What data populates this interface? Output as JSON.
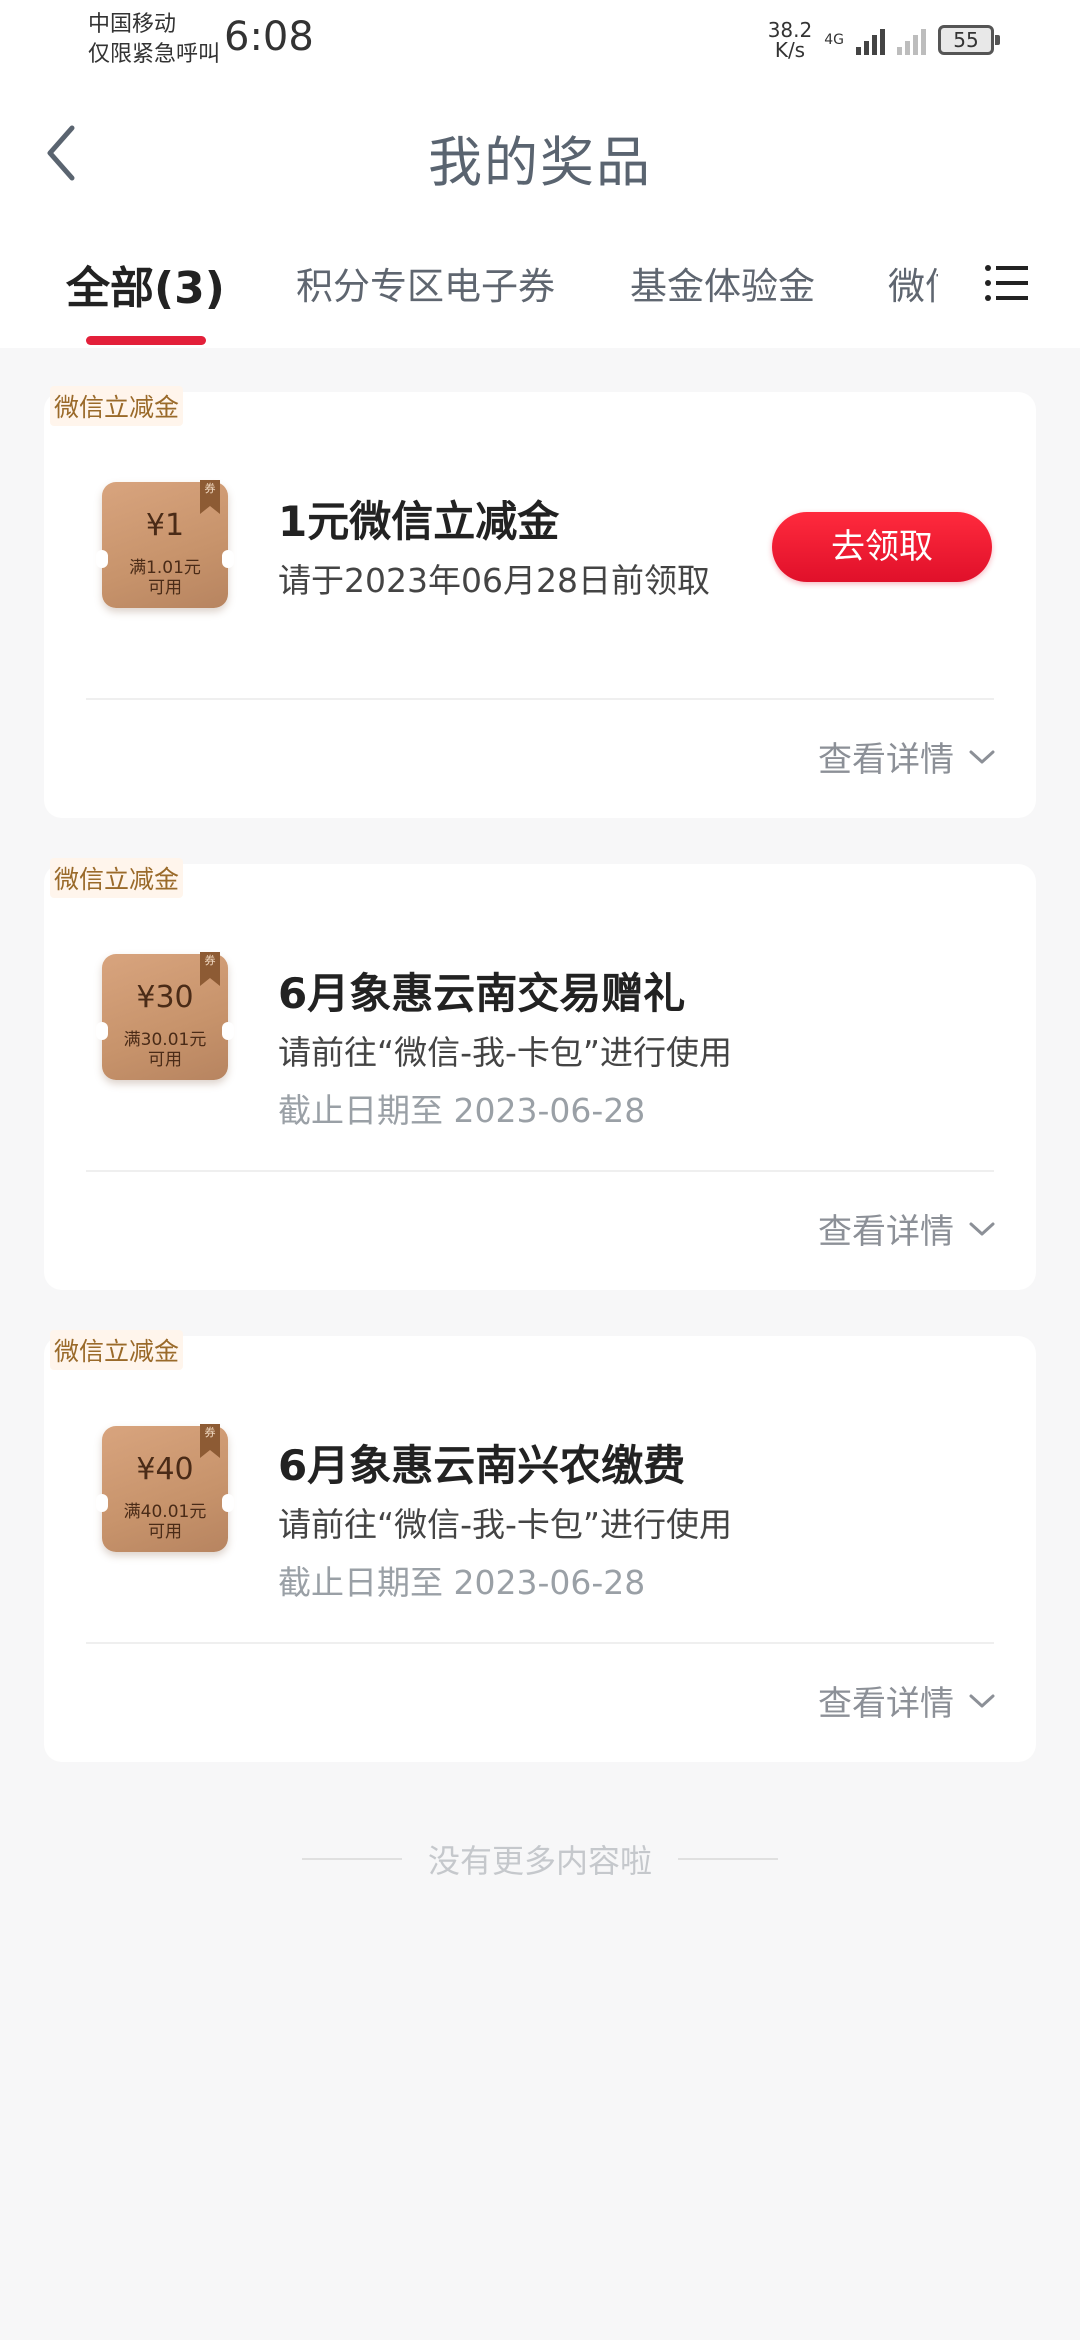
{
  "status_bar": {
    "carrier": "中国移动",
    "carrier_note": "仅限紧急呼叫",
    "time": "6:08",
    "net_speed_value": "38.2",
    "net_speed_unit": "K/s",
    "network_type": "4G",
    "battery": "55"
  },
  "header": {
    "title": "我的奖品"
  },
  "tabs": [
    {
      "label": "全部(3)",
      "active": true
    },
    {
      "label": "积分专区电子券",
      "active": false
    },
    {
      "label": "基金体验金",
      "active": false
    },
    {
      "label": "微信",
      "active": false
    }
  ],
  "cards": [
    {
      "tag": "微信立减金",
      "coupon_amount": "¥1",
      "coupon_condition_line1": "满1.01元",
      "coupon_condition_line2": "可用",
      "coupon_ribbon": "券",
      "title": "1元微信立减金",
      "desc": "请于2023年06月28日前领取",
      "deadline": "",
      "button_label": "去领取",
      "details_label": "查看详情"
    },
    {
      "tag": "微信立减金",
      "coupon_amount": "¥30",
      "coupon_condition_line1": "满30.01元",
      "coupon_condition_line2": "可用",
      "coupon_ribbon": "券",
      "title": "6月象惠云南交易赠礼",
      "desc": "请前往“微信-我-卡包”进行使用",
      "deadline": "截止日期至 2023-06-28",
      "button_label": "",
      "details_label": "查看详情"
    },
    {
      "tag": "微信立减金",
      "coupon_amount": "¥40",
      "coupon_condition_line1": "满40.01元",
      "coupon_condition_line2": "可用",
      "coupon_ribbon": "券",
      "title": "6月象惠云南兴农缴费",
      "desc": "请前往“微信-我-卡包”进行使用",
      "deadline": "截止日期至 2023-06-28",
      "button_label": "",
      "details_label": "查看详情"
    }
  ],
  "footer": {
    "end_note": "没有更多内容啦"
  },
  "colors": {
    "accent_red": "#e3203a",
    "coupon_bronze": "#c7936b",
    "tag_text": "#9a6a2a"
  },
  "icons": {
    "back": "chevron-left-icon",
    "menu": "list-menu-icon",
    "details": "chevron-down-icon"
  }
}
